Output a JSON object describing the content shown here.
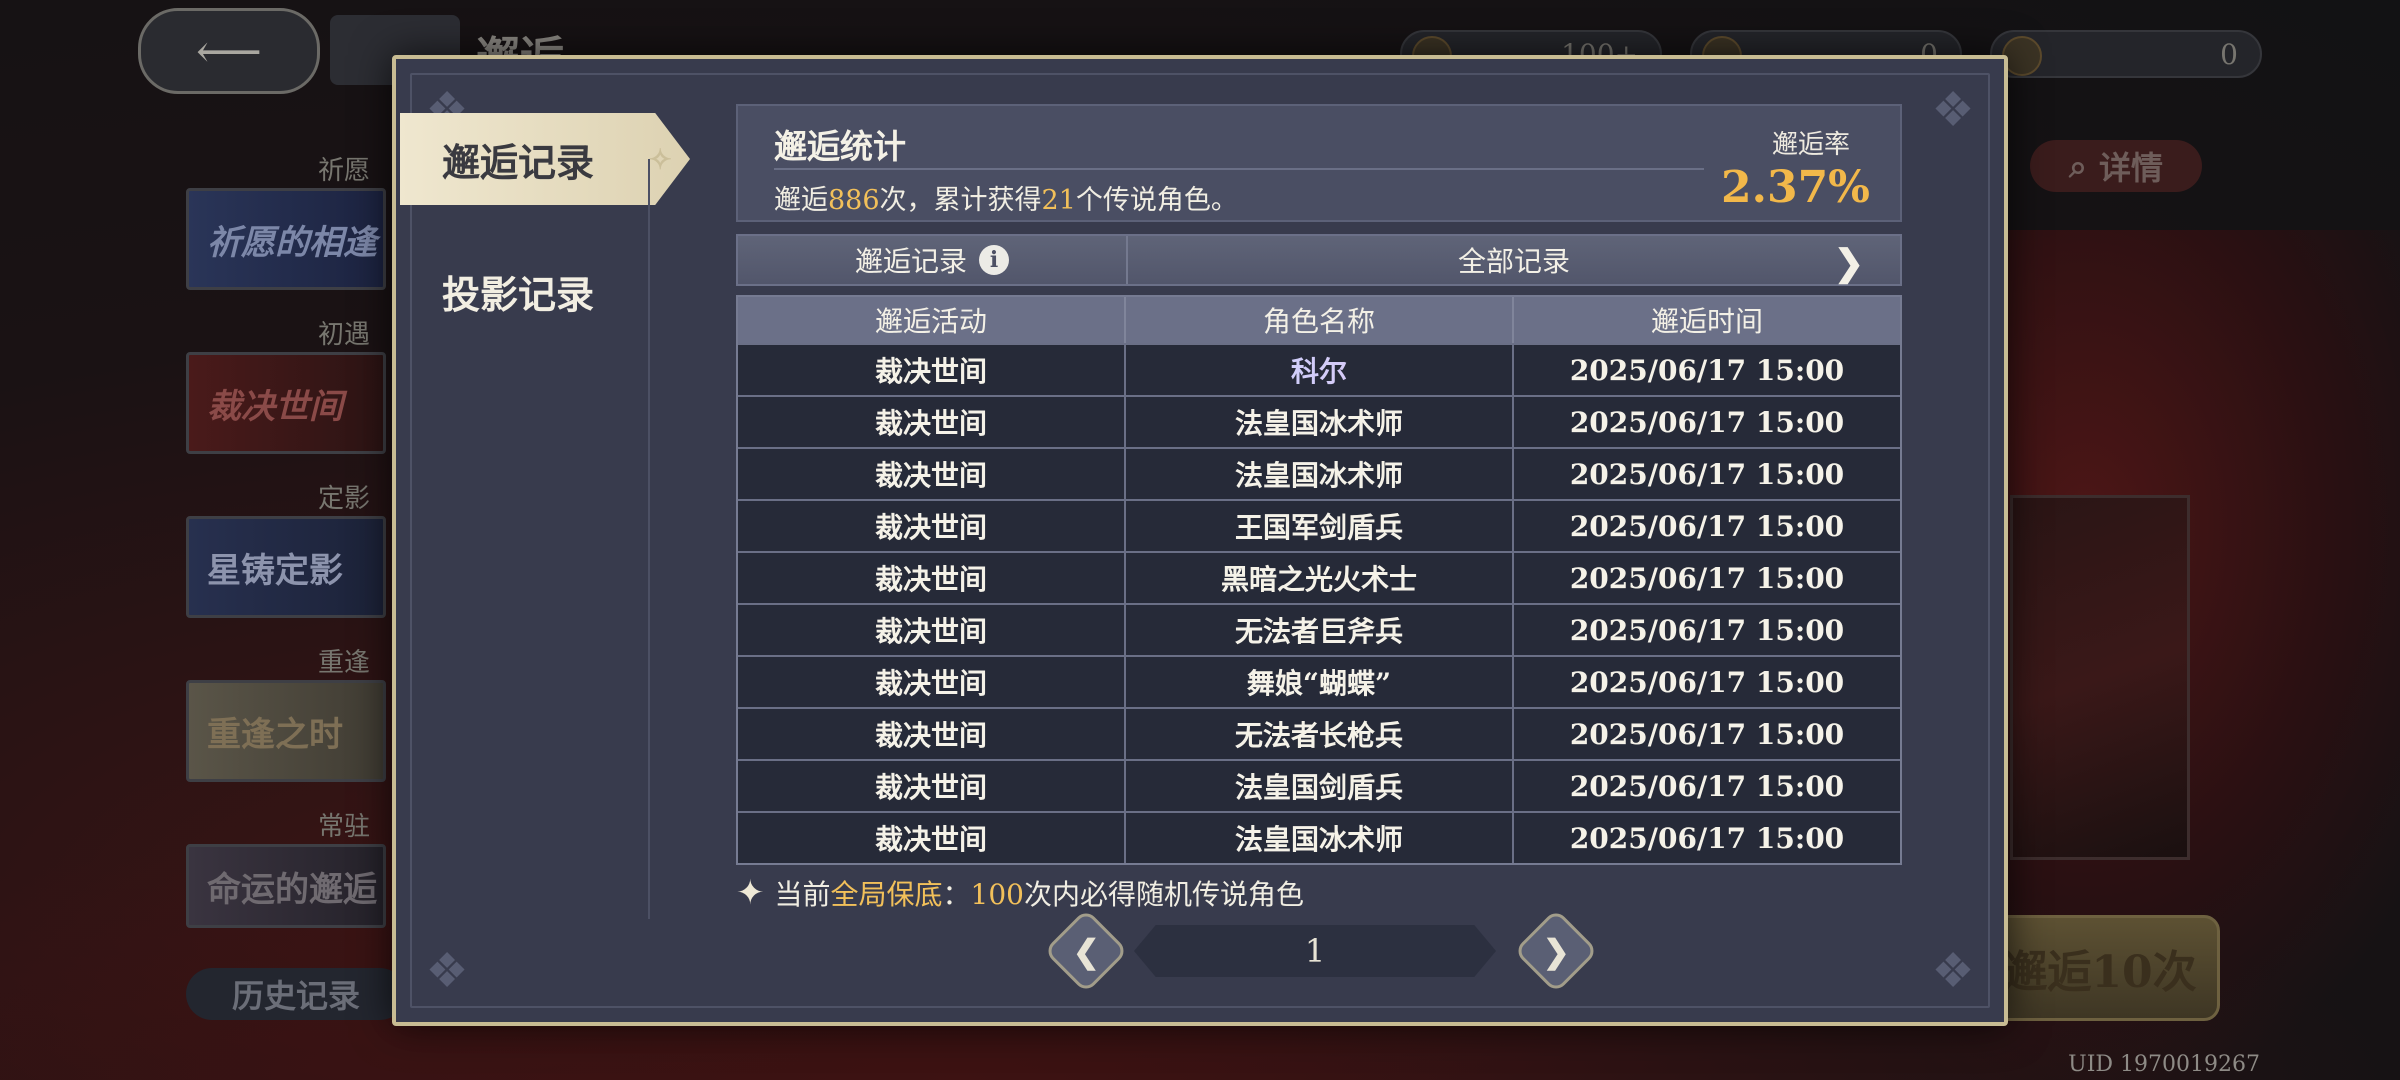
{
  "background": {
    "title": "邂逅",
    "resources": [
      "100+",
      "0",
      "0"
    ],
    "side_labels": [
      "祈愿",
      "初遇",
      "定影",
      "重逢",
      "常驻"
    ],
    "side_cards": [
      "祈愿的相逢",
      "裁决世间",
      "星铸定影",
      "重逢之时",
      "命运的邂逅"
    ],
    "history_button": "历史记录",
    "detail_button": "详情",
    "pull_ten_button": "邂逅10次",
    "uid": "UID 1970019267"
  },
  "tabs": {
    "active": "邂逅记录",
    "inactive": "投影记录"
  },
  "stats": {
    "title": "邂逅统计",
    "desc_prefix": "邂逅",
    "pull_count": "886",
    "desc_middle": "次，累计获得",
    "legend_count": "21",
    "desc_suffix": "个传说角色。",
    "rate_label": "邂逅率",
    "rate_value": "2.37%"
  },
  "filter": {
    "left_label": "邂逅记录",
    "info_icon": "i",
    "right_label": "全部记录",
    "arrow": "❯"
  },
  "table": {
    "headers": [
      "邂逅活动",
      "角色名称",
      "邂逅时间"
    ],
    "rows": [
      [
        "裁决世间",
        "科尔",
        "2025/06/17 15:00"
      ],
      [
        "裁决世间",
        "法皇国冰术师",
        "2025/06/17 15:00"
      ],
      [
        "裁决世间",
        "法皇国冰术师",
        "2025/06/17 15:00"
      ],
      [
        "裁决世间",
        "王国军剑盾兵",
        "2025/06/17 15:00"
      ],
      [
        "裁决世间",
        "黑暗之光火术士",
        "2025/06/17 15:00"
      ],
      [
        "裁决世间",
        "无法者巨斧兵",
        "2025/06/17 15:00"
      ],
      [
        "裁决世间",
        "舞娘“蝴蝶”",
        "2025/06/17 15:00"
      ],
      [
        "裁决世间",
        "无法者长枪兵",
        "2025/06/17 15:00"
      ],
      [
        "裁决世间",
        "法皇国剑盾兵",
        "2025/06/17 15:00"
      ],
      [
        "裁决世间",
        "法皇国冰术师",
        "2025/06/17 15:00"
      ]
    ]
  },
  "pity": {
    "prefix": "当前",
    "highlight": "全局保底",
    "colon": "：",
    "count": "100",
    "suffix": "次内必得随机传说角色"
  },
  "pagination": {
    "current_page": "1",
    "prev": "❮",
    "next": "❯"
  },
  "colors": {
    "accent_gold": "#f2c05a",
    "modal_border": "#c8bc93",
    "legend_name": "#c8b8f5"
  }
}
